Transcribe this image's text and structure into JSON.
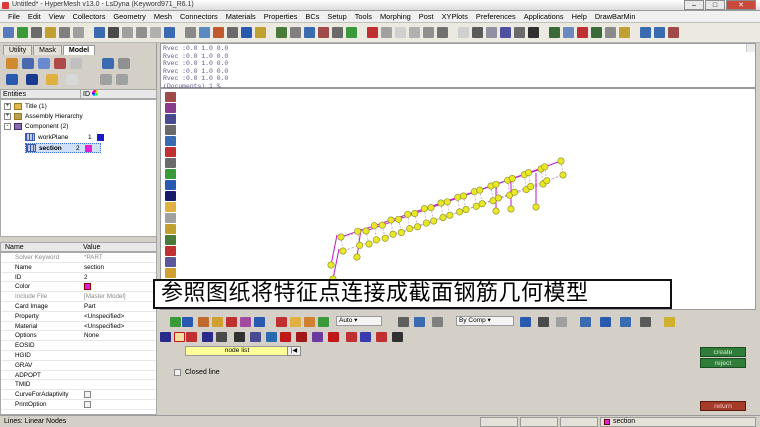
{
  "window": {
    "title": "Untitled* - HyperMesh v13.0 - LsDyna (Keyword971_R6.1)"
  },
  "menu": [
    "File",
    "Edit",
    "View",
    "Collectors",
    "Geometry",
    "Mesh",
    "Connectors",
    "Materials",
    "Properties",
    "BCs",
    "Setup",
    "Tools",
    "Morphing",
    "Post",
    "XYPlots",
    "Preferences",
    "Applications",
    "Help",
    "DrawBarMin"
  ],
  "left_tabs": [
    "Utility",
    "Mask",
    "Model"
  ],
  "entities_header": {
    "entities": "Entities",
    "id": "ID"
  },
  "tree": [
    {
      "label": "Title (1)"
    },
    {
      "label": "Assembly Hierarchy"
    },
    {
      "label": "Component (2)"
    },
    {
      "label": "workPlane",
      "id": "1",
      "color": "#1a1ac8"
    },
    {
      "label": "section",
      "id": "2",
      "color": "#e020d8"
    }
  ],
  "props_header": {
    "name": "Name",
    "value": "Value"
  },
  "props": [
    {
      "name": "Solver Keyword",
      "value": "*PART",
      "grey": true
    },
    {
      "name": "Name",
      "value": "section"
    },
    {
      "name": "ID",
      "value": "2"
    },
    {
      "name": "Color",
      "value": ""
    },
    {
      "name": "Include File",
      "value": "[Master Model]",
      "grey": true
    },
    {
      "name": "Card Image",
      "value": "Part"
    },
    {
      "name": "Property",
      "value": "<Unspecified>"
    },
    {
      "name": "Material",
      "value": "<Unspecified>"
    },
    {
      "name": "Options",
      "value": "None"
    },
    {
      "name": "EOSID",
      "value": ""
    },
    {
      "name": "HGID",
      "value": ""
    },
    {
      "name": "GRAV",
      "value": ""
    },
    {
      "name": "ADPOPT",
      "value": ""
    },
    {
      "name": "TMID",
      "value": ""
    },
    {
      "name": "CurveForAdaptivity",
      "value": ""
    },
    {
      "name": "PrintOption",
      "value": ""
    }
  ],
  "command_lines": [
    "Rvec :0.0 1.0 0.0",
    "Rvec :0.0 1.0 0.0",
    "Rvec :0.0 1.0 0.0",
    "Rvec :0.0 1.0 0.0",
    "Rvec :0.0 1.0 0.0",
    "(Documents) 1 %"
  ],
  "caption": "参照图纸将特征点连接成截面钢筋几何模型",
  "panel": {
    "auto_dropdown": "Auto",
    "bycomp_dropdown": "By Comp",
    "node_list": "node list",
    "closed_line": "Closed line",
    "create": "create",
    "reject": "reject",
    "return": "return"
  },
  "status": {
    "message": "Lines: Linear Nodes",
    "component": "section"
  },
  "colors": {
    "node": "#e8e828",
    "line_main": "#c018c0",
    "line_dash": "#c8a8c8"
  }
}
